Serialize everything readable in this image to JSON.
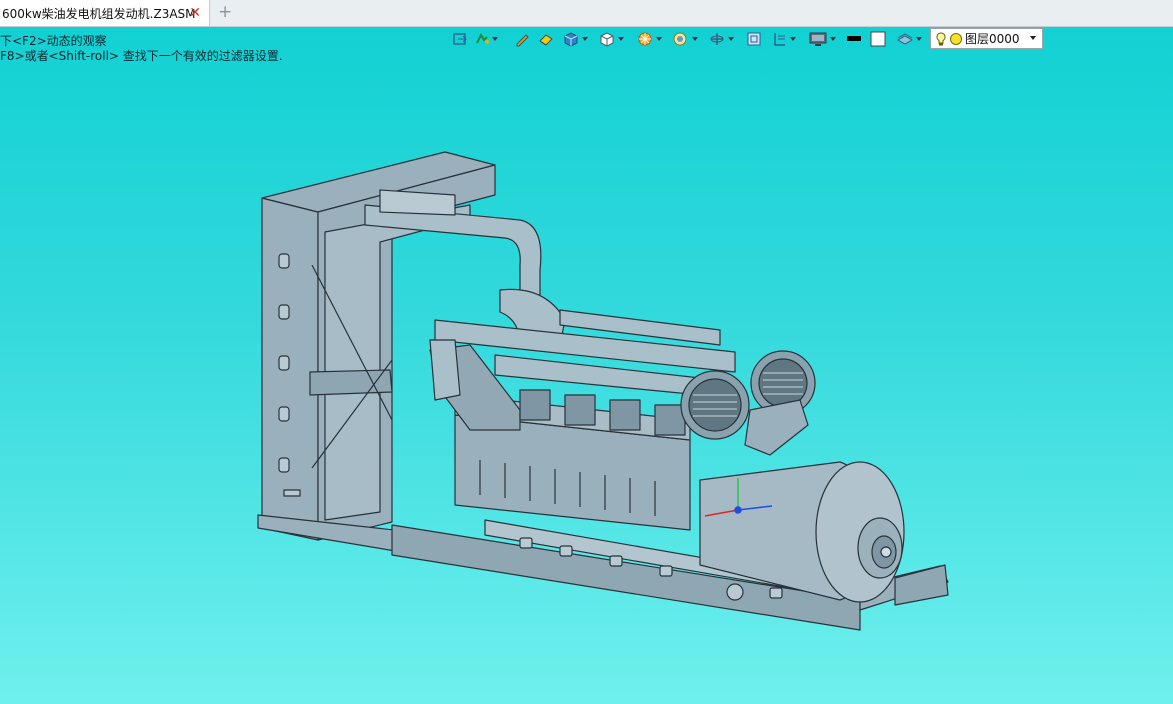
{
  "tab": {
    "title": "600kw柴油发电机组发动机.Z3ASM"
  },
  "hints": {
    "line1": "下<F2>动态的观察",
    "line2": "F8>或者<Shift-roll> 查找下一个有效的过滤器设置."
  },
  "toolbar": {
    "icons": [
      "frame-icon",
      "pick-filter-icon",
      "pen-icon",
      "eraser-icon",
      "shaded-cube-icon",
      "wire-cube-icon",
      "render-mode-icon",
      "zoom-icon",
      "rotate-icon",
      "fit-view-icon",
      "section-icon",
      "display-icon",
      "black-color-swatch",
      "white-color-swatch",
      "layer-plane-icon"
    ]
  },
  "layer": {
    "value": "图层0000"
  },
  "colors": {
    "background_top": "#0fd0d2",
    "background_bottom": "#6ff0ee",
    "model": "#9ab0bc",
    "model_edge": "#27323a"
  }
}
